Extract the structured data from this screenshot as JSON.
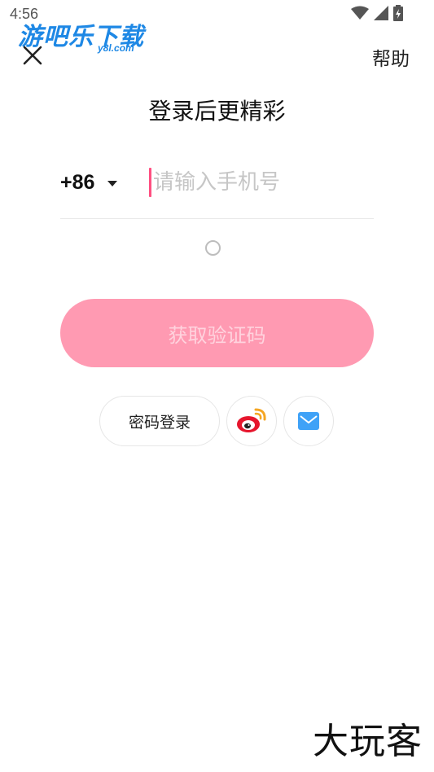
{
  "status_bar": {
    "time": "4:56"
  },
  "watermark": {
    "text": "游吧乐下载",
    "sub": "y8l.com"
  },
  "header": {
    "help_label": "帮助"
  },
  "page": {
    "title": "登录后更精彩"
  },
  "phone": {
    "country_code": "+86",
    "placeholder": "请输入手机号",
    "value": ""
  },
  "actions": {
    "get_code_label": "获取验证码",
    "password_login_label": "密码登录"
  },
  "icons": {
    "close": "close-icon",
    "caret": "caret-down-icon",
    "weibo": "weibo-icon",
    "email": "email-icon",
    "wifi": "wifi-icon",
    "signal": "signal-icon",
    "battery": "battery-icon"
  },
  "colors": {
    "primary_button": "#ff9ab2",
    "primary_button_text": "#ffd3de",
    "cursor": "#ff4f81",
    "email_icon": "#3fa2f7",
    "weibo_red": "#e6162d",
    "weibo_orange": "#f5a623"
  },
  "footer": {
    "brand": "大玩客"
  }
}
